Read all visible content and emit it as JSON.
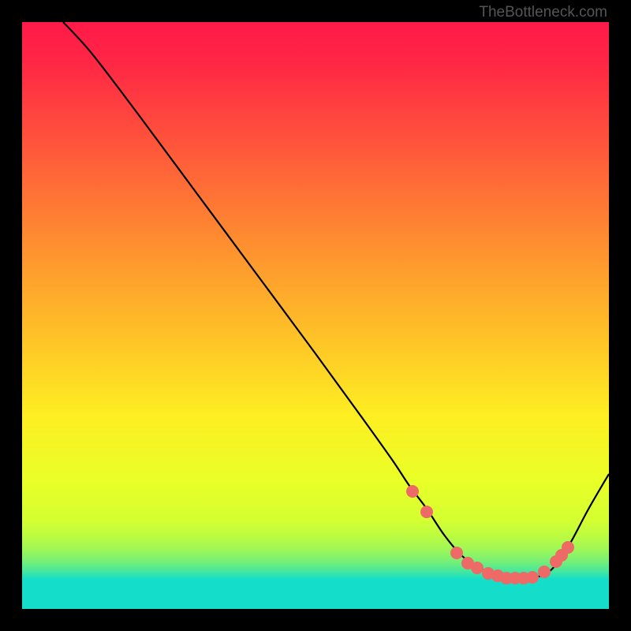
{
  "watermark": "TheBottleneck.com",
  "chart_data": {
    "type": "line",
    "title": "",
    "xlabel": "",
    "ylabel": "",
    "xlim": [
      0,
      100
    ],
    "ylim": [
      0,
      100
    ],
    "grid": false,
    "gradient_stops": [
      {
        "offset": 0.0,
        "color": "#ff1a49"
      },
      {
        "offset": 0.07,
        "color": "#ff2745"
      },
      {
        "offset": 0.22,
        "color": "#ff593a"
      },
      {
        "offset": 0.37,
        "color": "#fe8c30"
      },
      {
        "offset": 0.52,
        "color": "#febd28"
      },
      {
        "offset": 0.67,
        "color": "#feee22"
      },
      {
        "offset": 0.78,
        "color": "#eaff27"
      },
      {
        "offset": 0.85,
        "color": "#d4ff31"
      },
      {
        "offset": 0.88,
        "color": "#b7fb44"
      },
      {
        "offset": 0.9,
        "color": "#9cf659"
      },
      {
        "offset": 0.92,
        "color": "#74ef79"
      },
      {
        "offset": 0.935,
        "color": "#49e79b"
      },
      {
        "offset": 0.945,
        "color": "#25e1b8"
      },
      {
        "offset": 0.95,
        "color": "#12deca"
      },
      {
        "offset": 0.953,
        "color": "#14deca"
      },
      {
        "offset": 1.0,
        "color": "#14deca"
      }
    ],
    "series": [
      {
        "name": "bottleneck-curve",
        "color": "#000000",
        "x": [
          7,
          12,
          20,
          30,
          40,
          50,
          58,
          63,
          66,
          69,
          72,
          75,
          78,
          81,
          84,
          87,
          90,
          93,
          96.5,
          100
        ],
        "y": [
          100,
          94.5,
          84,
          70.5,
          57,
          43.5,
          32.5,
          25.5,
          21,
          17,
          12.5,
          9,
          7,
          5.6,
          5.2,
          5.3,
          6.5,
          10.5,
          17,
          23
        ]
      }
    ],
    "dots": {
      "color": "#ed6a66",
      "points": [
        {
          "x": 66.5,
          "y": 20
        },
        {
          "x": 69,
          "y": 16.5
        },
        {
          "x": 74,
          "y": 9.5
        },
        {
          "x": 76,
          "y": 7.8
        },
        {
          "x": 77.5,
          "y": 7
        },
        {
          "x": 79.5,
          "y": 6
        },
        {
          "x": 81,
          "y": 5.6
        },
        {
          "x": 82.5,
          "y": 5.3
        },
        {
          "x": 84,
          "y": 5.2
        },
        {
          "x": 85.5,
          "y": 5.3
        },
        {
          "x": 87,
          "y": 5.4
        },
        {
          "x": 89,
          "y": 6.3
        },
        {
          "x": 91,
          "y": 8
        },
        {
          "x": 92,
          "y": 9.2
        },
        {
          "x": 93,
          "y": 10.5
        }
      ]
    }
  }
}
